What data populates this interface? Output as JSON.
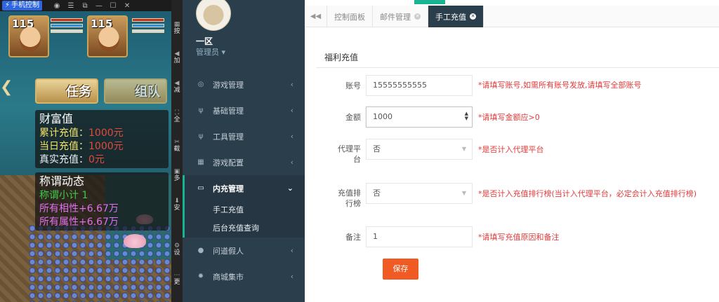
{
  "game": {
    "phone_control_label": "手机控制",
    "level_left": "115",
    "level_right": "115",
    "btn_task": "任务",
    "btn_team": "组队",
    "wealth": {
      "title": "财富值",
      "rows": [
        {
          "label": "累计充值：",
          "value": "1000元"
        },
        {
          "label": "当日充值：",
          "value": "1000元"
        },
        {
          "label": "真实充值：",
          "value": "0元"
        }
      ]
    },
    "title_panel": {
      "title": "称谓动态",
      "subtotal": "称谓小计 1",
      "affinity": "所有相性+6.67万",
      "attribute": "所有属性+6.67万"
    },
    "strip_items": [
      "按",
      "加",
      "减",
      "全",
      "截",
      "多",
      "安",
      "设",
      "更"
    ]
  },
  "sidebar": {
    "user_name": "一区",
    "user_role": "管理员",
    "menu": [
      {
        "label": "游戏管理",
        "icon": "gamepad-icon"
      },
      {
        "label": "基础管理",
        "icon": "cutlery-icon"
      },
      {
        "label": "工具管理",
        "icon": "cutlery-icon"
      },
      {
        "label": "游戏配置",
        "icon": "table-icon"
      },
      {
        "label": "内充管理",
        "icon": "monitor-icon"
      }
    ],
    "submenu": [
      "手工充值",
      "后台充值查询"
    ],
    "menu_after": [
      {
        "label": "问道假人",
        "icon": "user-icon"
      },
      {
        "label": "商城集市",
        "icon": "gear-icon"
      }
    ]
  },
  "tabs": {
    "items": [
      "控制面板",
      "邮件管理",
      "手工充值"
    ]
  },
  "form": {
    "card_title": "福利充值",
    "account": {
      "label": "账号",
      "value": "15555555555",
      "hint": "*请填写账号,如需所有账号发放,请填写全部账号"
    },
    "amount": {
      "label": "金额",
      "value": "1000",
      "hint": "*请填写金额应>0"
    },
    "agent": {
      "label": "代理平台",
      "value": "否",
      "hint": "*是否计入代理平台"
    },
    "ranking": {
      "label": "充值排行榜",
      "value": "否",
      "hint": "*是否计入充值排行榜(当计入代理平台，必定会计入充值排行榜)"
    },
    "remark": {
      "label": "备注",
      "value": "1",
      "hint": "*请填写充值原因和备注"
    },
    "save_label": "保存"
  },
  "colors": {
    "accent": "#1ab394",
    "sidebar_bg": "#2b3e4c",
    "save_button": "#f05a23",
    "hint": "#e23b3b"
  }
}
